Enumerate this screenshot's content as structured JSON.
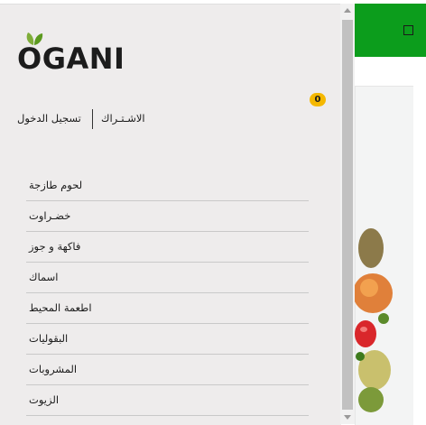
{
  "brand": {
    "logo_text": "OGANI"
  },
  "cart": {
    "count": "0"
  },
  "auth": {
    "register_label": "الاشـتـراك",
    "login_label": "تسجيل الدخول"
  },
  "menu": {
    "items": [
      {
        "label": "لحوم طازجة"
      },
      {
        "label": "خضـراوت"
      },
      {
        "label": "فاكهة و جوز"
      },
      {
        "label": "اسماك"
      },
      {
        "label": "اطعمة المحيط"
      },
      {
        "label": "البقوليات"
      },
      {
        "label": "المشروبات"
      },
      {
        "label": "الزيوت"
      }
    ]
  },
  "colors": {
    "brand_green": "#0c9d1c",
    "leaf_green": "#7fad39",
    "badge_yellow": "#f5b800"
  },
  "icons": {
    "menu_toggle": "square-menu-icon"
  }
}
